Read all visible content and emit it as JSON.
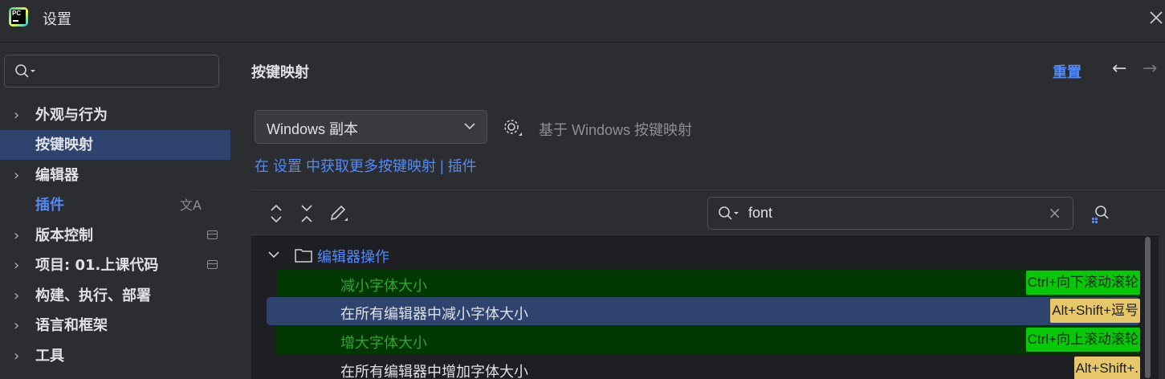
{
  "window": {
    "title": "设置",
    "logo_text": "PC"
  },
  "sidebar": {
    "search_placeholder": "",
    "items": [
      {
        "label": "外观与行为",
        "expandable": true
      },
      {
        "label": "按键映射",
        "expandable": false,
        "selected": true
      },
      {
        "label": "编辑器",
        "expandable": true
      },
      {
        "label": "插件",
        "expandable": false
      },
      {
        "label": "版本控制",
        "expandable": true
      },
      {
        "label": "项目: 01.上课代码",
        "expandable": true
      },
      {
        "label": "构建、执行、部署",
        "expandable": true
      },
      {
        "label": "语言和框架",
        "expandable": true
      },
      {
        "label": "工具",
        "expandable": true
      }
    ]
  },
  "main": {
    "title": "按键映射",
    "reset_label": "重置",
    "keymap_select_value": "Windows 副本",
    "based_on": "基于 Windows 按键映射",
    "more_link": "在 设置 中获取更多按键映射 | 插件",
    "filter_value": "font"
  },
  "tree": {
    "group_label": "编辑器操作",
    "rows": [
      {
        "label": "减小字体大小",
        "shortcut": "Ctrl+向下滚动滚轮",
        "style": "green"
      },
      {
        "label": "在所有编辑器中减小字体大小",
        "shortcut": "Alt+Shift+逗号",
        "style": "selected"
      },
      {
        "label": "增大字体大小",
        "shortcut": "Ctrl+向上滚动滚轮",
        "style": "green"
      },
      {
        "label": "在所有编辑器中增加字体大小",
        "shortcut": "Alt+Shift+.",
        "style": "plain"
      }
    ]
  },
  "colors": {
    "background": "#2b2d30",
    "accent": "#548af7",
    "selection": "#2e436e",
    "highlight_green": "#06c806",
    "shortcut_yellow": "#e6c76a"
  }
}
